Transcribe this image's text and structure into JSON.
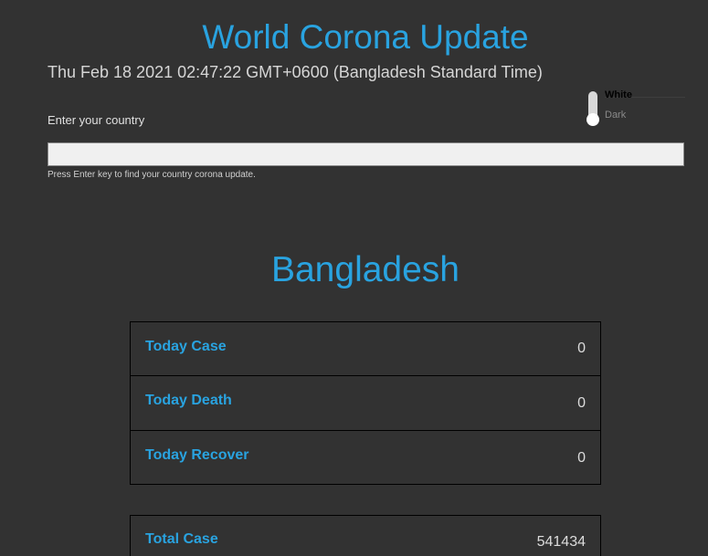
{
  "header": {
    "title": "World Corona Update",
    "datetime": "Thu Feb 18 2021 02:47:22 GMT+0600 (Bangladesh Standard Time)"
  },
  "theme": {
    "white_label": "White",
    "dark_label": "Dark",
    "selected": "Dark"
  },
  "search": {
    "label": "Enter your country",
    "value": "",
    "placeholder": "",
    "hint": "Press Enter key to find your country corona update."
  },
  "country": {
    "name": "Bangladesh"
  },
  "today_stats": [
    {
      "label": "Today Case",
      "value": "0"
    },
    {
      "label": "Today Death",
      "value": "0"
    },
    {
      "label": "Today Recover",
      "value": "0"
    }
  ],
  "total_stats": [
    {
      "label": "Total Case",
      "value": "541434"
    }
  ],
  "colors": {
    "accent": "#29a3e0",
    "background": "#323232"
  }
}
